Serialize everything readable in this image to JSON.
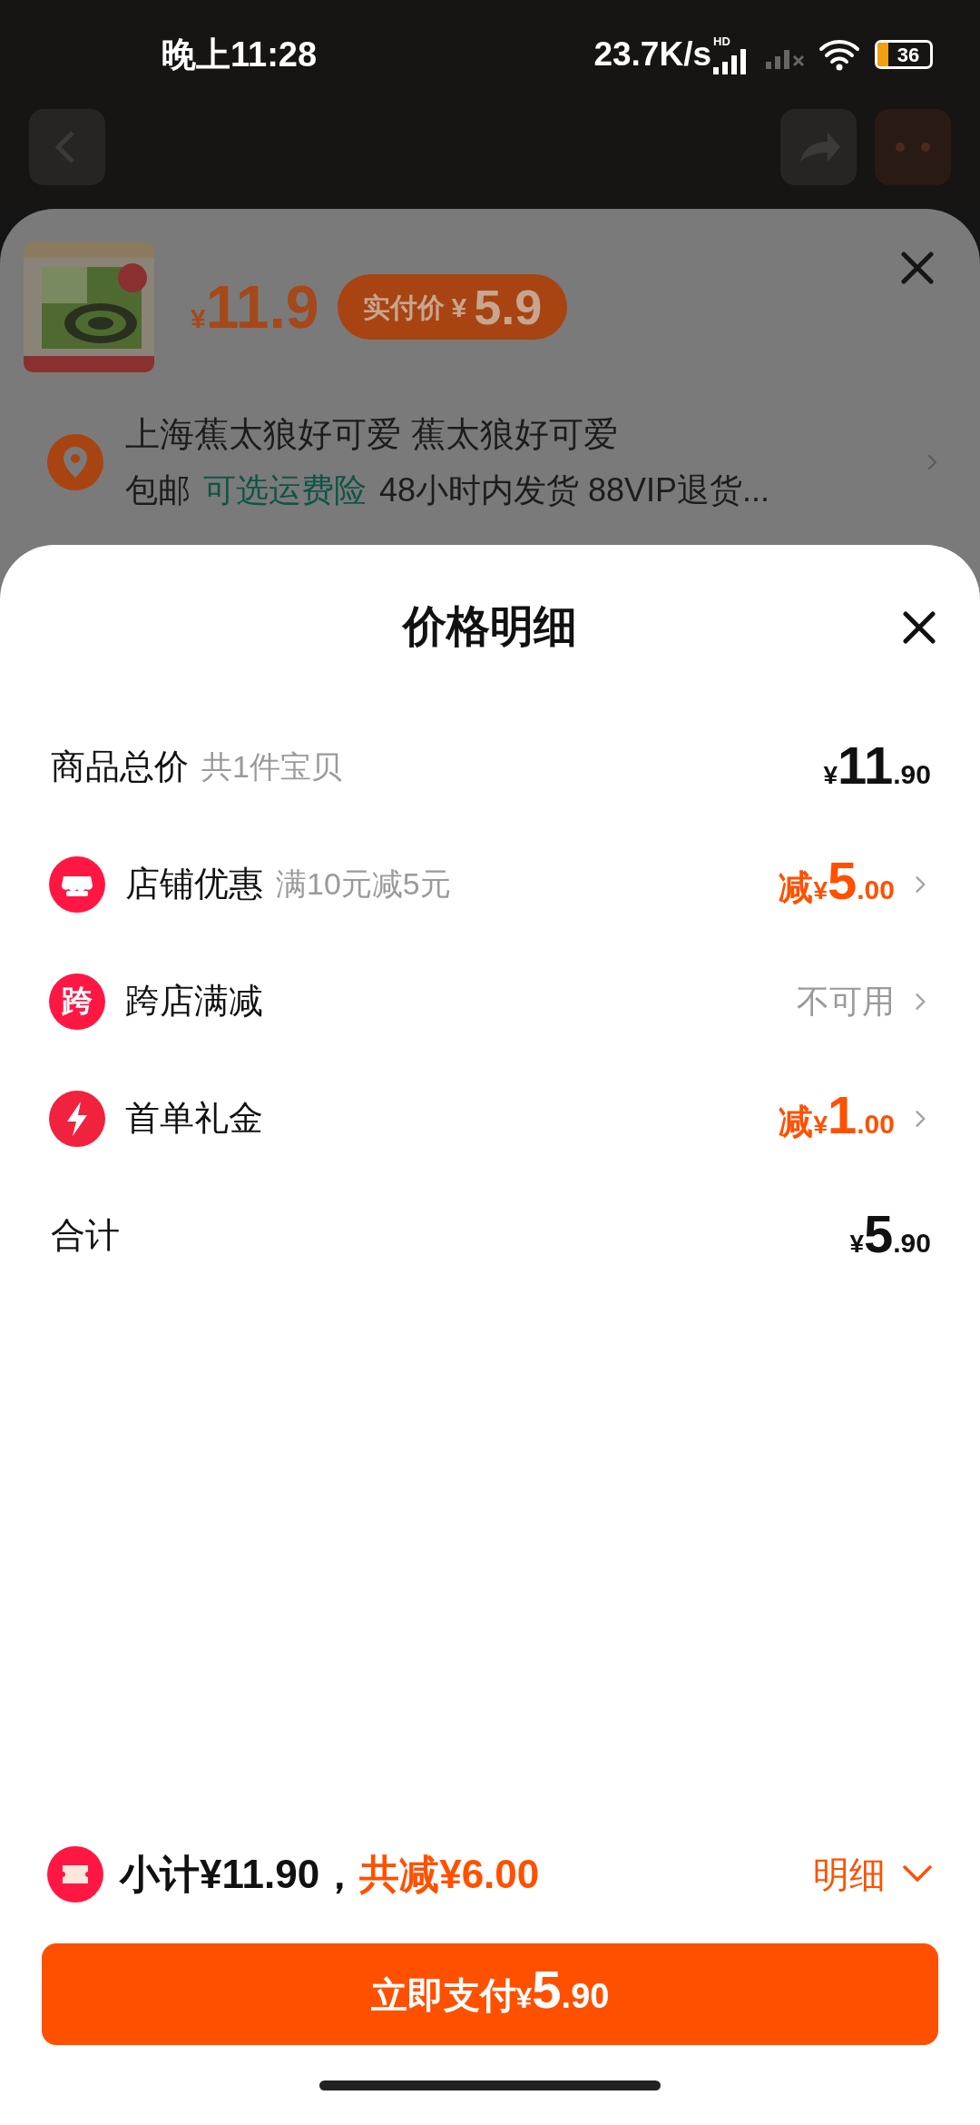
{
  "status_bar": {
    "time": "晚上11:28",
    "net_speed": "23.7K/s",
    "network_badge": "HD",
    "battery": "36"
  },
  "product_sheet": {
    "price": {
      "currency": "¥",
      "value": "11.9"
    },
    "pay_badge": {
      "label": "实付价",
      "currency": "¥",
      "value": "5.9"
    },
    "address": "上海蕉太狼好可爱 蕉太狼好可爱",
    "shipping": [
      {
        "text": "包邮",
        "kind": "plain"
      },
      {
        "text": "可选运费险",
        "kind": "link"
      },
      {
        "text": "48小时内发货 88VIP退货...",
        "kind": "plain"
      }
    ]
  },
  "price_detail": {
    "title": "价格明细",
    "rows": [
      {
        "kind": "total",
        "label": "商品总价",
        "note": "共1件宝贝",
        "amount": {
          "currency": "¥",
          "integer": "11",
          "decimal": ".90",
          "discount": false
        }
      },
      {
        "kind": "store",
        "label": "店铺优惠",
        "note": "满10元减5元",
        "amount": {
          "prefix": "减",
          "currency": "¥",
          "integer": "5",
          "decimal": ".00",
          "discount": true
        }
      },
      {
        "kind": "cross",
        "icon_text": "跨",
        "label": "跨店满减",
        "status": "不可用"
      },
      {
        "kind": "gift",
        "label": "首单礼金",
        "amount": {
          "prefix": "减",
          "currency": "¥",
          "integer": "1",
          "decimal": ".00",
          "discount": true
        }
      },
      {
        "kind": "total",
        "label": "合计",
        "amount": {
          "currency": "¥",
          "integer": "5",
          "decimal": ".90",
          "discount": false
        }
      }
    ]
  },
  "footer": {
    "subtotal": "小计¥11.90，",
    "discount": "共减¥6.00",
    "detail_toggle": "明细",
    "expanded": false,
    "pay_button": {
      "label": "立即支付",
      "currency": "¥",
      "integer": "5",
      "decimal": ".90"
    }
  }
}
